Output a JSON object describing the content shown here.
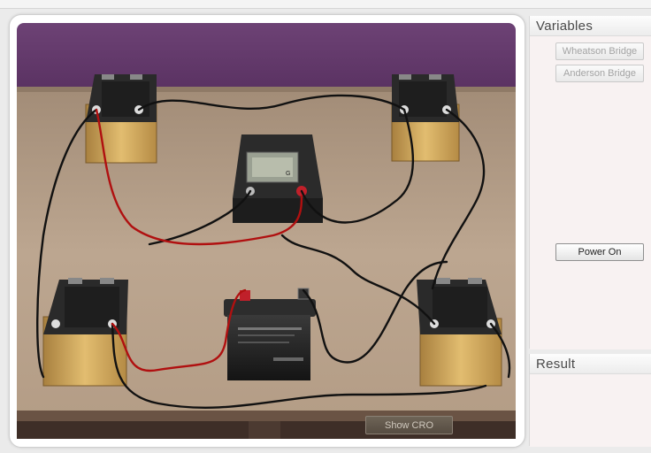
{
  "panels": {
    "variables_title": "Variables",
    "result_title": "Result"
  },
  "buttons": {
    "wheatson_bridge": "Wheatson Bridge",
    "anderson_bridge": "Anderson Bridge",
    "power_on": "Power On",
    "show_cro": "Show CRO"
  },
  "galvanometer": {
    "label": "G"
  },
  "colors": {
    "wall": "#6a3f72",
    "table": "#b9a38c",
    "wire_black": "#111111",
    "wire_red": "#b01010"
  }
}
